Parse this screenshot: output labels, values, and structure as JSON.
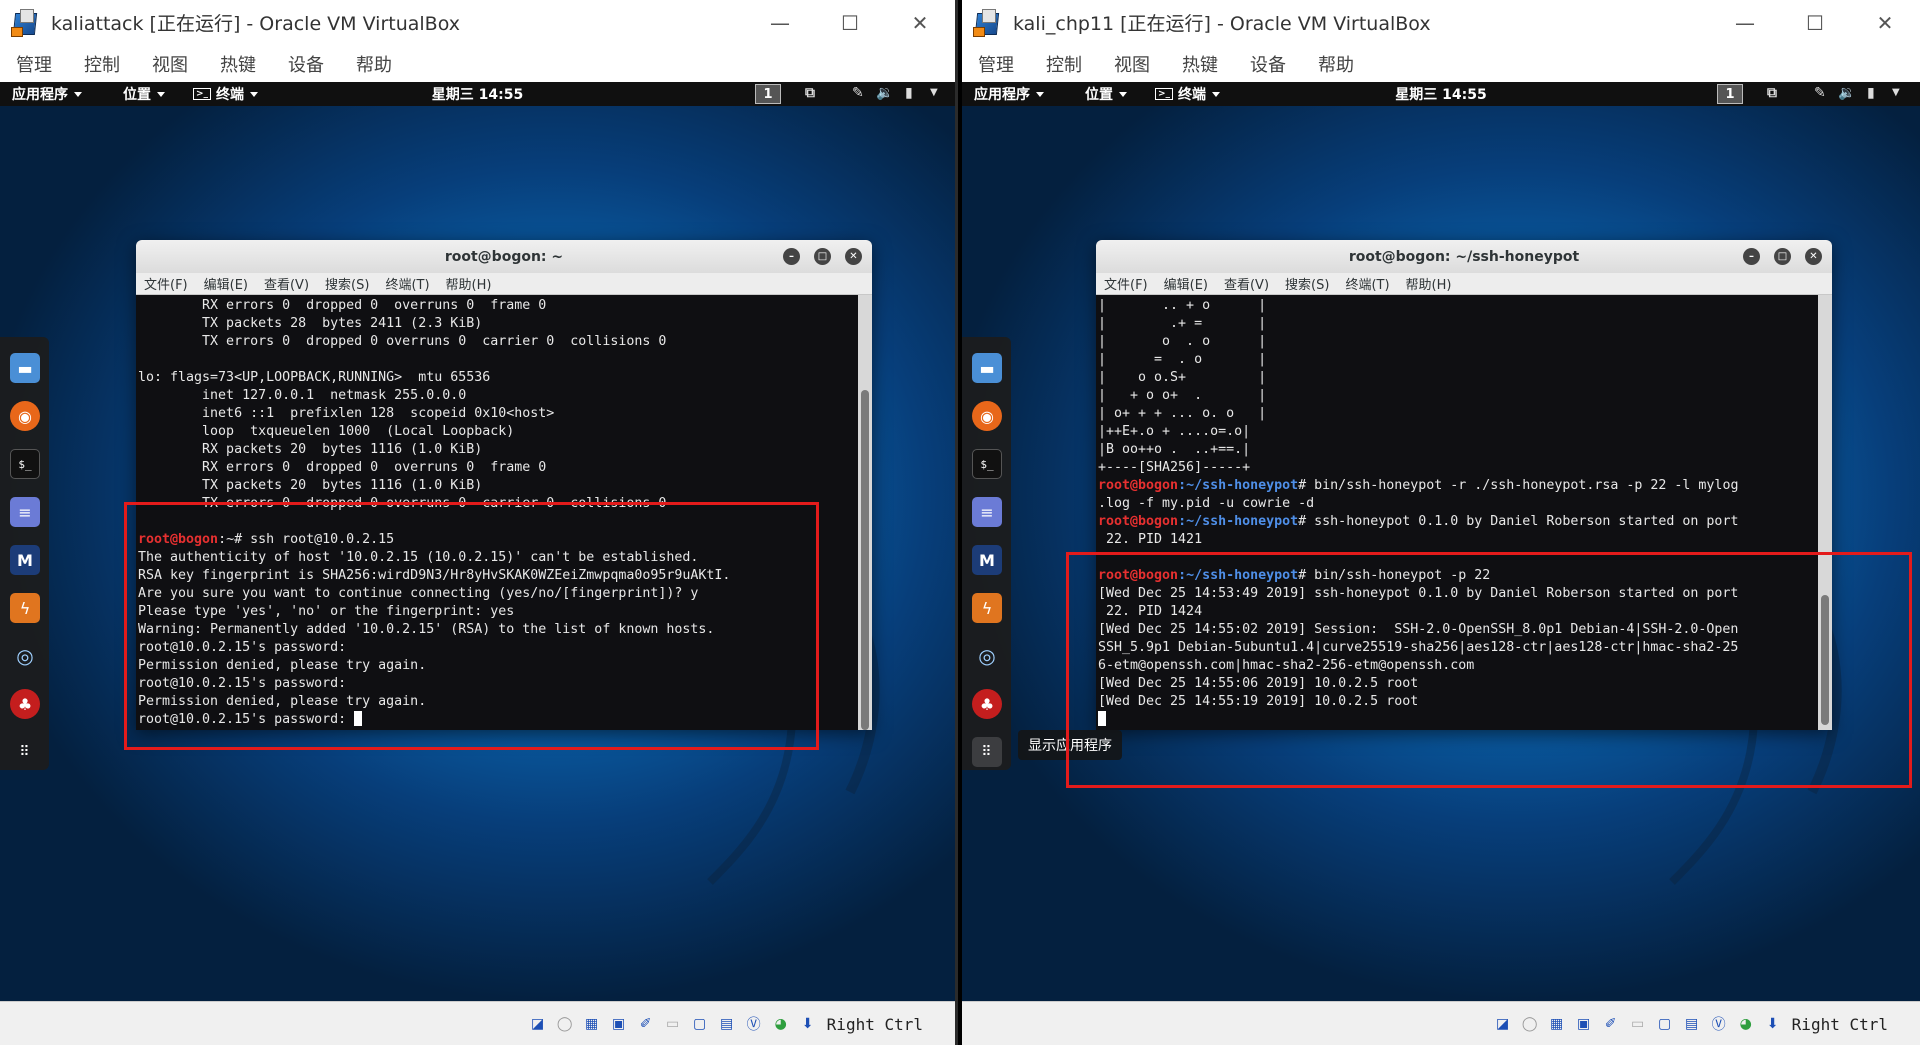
{
  "left": {
    "window_title": "kaliattack [正在运行] - Oracle VM VirtualBox",
    "menu": [
      "管理",
      "控制",
      "视图",
      "热键",
      "设备",
      "帮助"
    ],
    "topbar": {
      "apps": "应用程序",
      "places": "位置",
      "terminal": "终端",
      "clock": "星期三 14:55",
      "workspace": "1"
    },
    "terminal": {
      "title": "root@bogon: ~",
      "menu": [
        "文件(F)",
        "编辑(E)",
        "查看(V)",
        "搜索(S)",
        "终端(T)",
        "帮助(H)"
      ],
      "lines_plain": [
        "        RX errors 0  dropped 0  overruns 0  frame 0",
        "        TX packets 28  bytes 2411 (2.3 KiB)",
        "        TX errors 0  dropped 0 overruns 0  carrier 0  collisions 0",
        "",
        "lo: flags=73<UP,LOOPBACK,RUNNING>  mtu 65536",
        "        inet 127.0.0.1  netmask 255.0.0.0",
        "        inet6 ::1  prefixlen 128  scopeid 0x10<host>",
        "        loop  txqueuelen 1000  (Local Loopback)",
        "        RX packets 20  bytes 1116 (1.0 KiB)",
        "        RX errors 0  dropped 0  overruns 0  frame 0",
        "        TX packets 20  bytes 1116 (1.0 KiB)",
        "        TX errors 0  dropped 0 overruns 0  carrier 0  collisions 0",
        ""
      ],
      "prompt_user": "root@bogon",
      "prompt_path": ":~",
      "command": "# ssh root@10.0.2.15",
      "lines_after": [
        "The authenticity of host '10.0.2.15 (10.0.2.15)' can't be established.",
        "RSA key fingerprint is SHA256:wirdD9N3/Hr8yHvSKAK0WZEeiZmwpqma0o95r9uAKtI.",
        "Are you sure you want to continue connecting (yes/no/[fingerprint])? y",
        "Please type 'yes', 'no' or the fingerprint: yes",
        "Warning: Permanently added '10.0.2.15' (RSA) to the list of known hosts.",
        "root@10.0.2.15's password:",
        "Permission denied, please try again.",
        "root@10.0.2.15's password:",
        "Permission denied, please try again."
      ],
      "last_line": "root@10.0.2.15's password: "
    },
    "host_key": "Right Ctrl"
  },
  "right": {
    "window_title": "kali_chp11 [正在运行] - Oracle VM VirtualBox",
    "menu": [
      "管理",
      "控制",
      "视图",
      "热键",
      "设备",
      "帮助"
    ],
    "topbar": {
      "apps": "应用程序",
      "places": "位置",
      "terminal": "终端",
      "clock": "星期三 14:55",
      "workspace": "1"
    },
    "terminal": {
      "title": "root@bogon: ~/ssh-honeypot",
      "menu": [
        "文件(F)",
        "编辑(E)",
        "查看(V)",
        "搜索(S)",
        "终端(T)",
        "帮助(H)"
      ],
      "art": [
        "|       .. + o      |",
        "|        .+ =       |",
        "|       o  . o      |",
        "|      =  . o       |",
        "|    o o.S+         |",
        "|   + o o+  .       |",
        "| o+ + + ... o. o   |",
        "|++E+.o + ....o=.o|",
        "|B oo++o .  ..+==.|",
        "+----[SHA256]-----+"
      ],
      "prompt_user": "root@bogon",
      "prompt_path": ":~/ssh-honeypot",
      "cmd1": "# bin/ssh-honeypot -r ./ssh-honeypot.rsa -p 22 -l mylog",
      "cmd1_wrap": ".log -f my.pid -u cowrie -d",
      "cmd2": "# ssh-honeypot 0.1.0 by Daniel Roberson started on port",
      "cmd2_wrap": " 22. PID 1421",
      "cmd3": "# bin/ssh-honeypot -p 22",
      "output": [
        "[Wed Dec 25 14:53:49 2019] ssh-honeypot 0.1.0 by Daniel Roberson started on port",
        " 22. PID 1424",
        "[Wed Dec 25 14:55:02 2019] Session:  SSH-2.0-OpenSSH_8.0p1 Debian-4|SSH-2.0-Open",
        "SSH_5.9p1 Debian-5ubuntu1.4|curve25519-sha256|aes128-ctr|aes128-ctr|hmac-sha2-25",
        "6-etm@openssh.com|hmac-sha2-256-etm@openssh.com",
        "[Wed Dec 25 14:55:06 2019] 10.0.2.5 root",
        "[Wed Dec 25 14:55:19 2019] 10.0.2.5 root"
      ]
    },
    "tooltip": "显示应用程序",
    "host_key": "Right Ctrl"
  }
}
